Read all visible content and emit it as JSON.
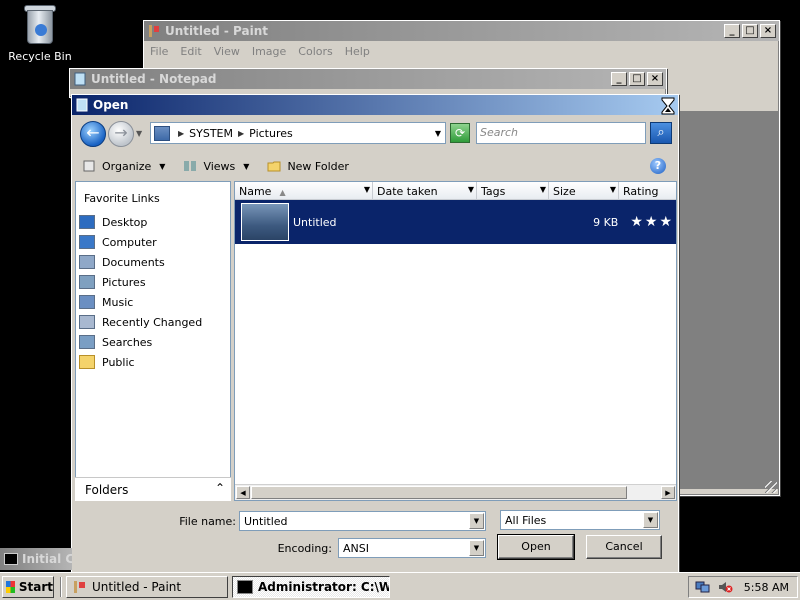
{
  "desktop": {
    "recycle_bin_label": "Recycle Bin"
  },
  "paint": {
    "title": "Untitled - Paint",
    "menu": [
      "File",
      "Edit",
      "View",
      "Image",
      "Colors",
      "Help"
    ]
  },
  "notepad": {
    "title": "Untitled - Notepad"
  },
  "dialog": {
    "title": "Open",
    "breadcrumb": [
      "SYSTEM",
      "Pictures"
    ],
    "search_placeholder": "Search",
    "toolbar": {
      "organize": "Organize",
      "views": "Views",
      "new_folder": "New Folder"
    },
    "favorite_links_header": "Favorite Links",
    "favorites": [
      {
        "label": "Desktop",
        "icon": "desktop-icon"
      },
      {
        "label": "Computer",
        "icon": "computer-icon"
      },
      {
        "label": "Documents",
        "icon": "documents-icon"
      },
      {
        "label": "Pictures",
        "icon": "pictures-icon"
      },
      {
        "label": "Music",
        "icon": "music-icon"
      },
      {
        "label": "Recently Changed",
        "icon": "recently-changed-icon"
      },
      {
        "label": "Searches",
        "icon": "searches-icon"
      },
      {
        "label": "Public",
        "icon": "public-folder-icon"
      }
    ],
    "folders_label": "Folders",
    "columns": [
      "Name",
      "Date taken",
      "Tags",
      "Size",
      "Rating"
    ],
    "files": [
      {
        "name": "Untitled",
        "size": "9 KB",
        "rating": "★★★"
      }
    ],
    "file_name_label": "File name:",
    "file_name_value": "Untitled",
    "file_type_value": "All Files",
    "encoding_label": "Encoding:",
    "encoding_value": "ANSI",
    "open_button": "Open",
    "cancel_button": "Cancel"
  },
  "console_window": {
    "title": "Initial Co"
  },
  "taskbar": {
    "start_label": "Start",
    "tasks": [
      "Untitled - Paint",
      "Administrator: C:\\Win..."
    ],
    "clock": "5:58 AM"
  },
  "colors": {
    "selection": "#0a246a",
    "active_title_start": "#0a246a",
    "inactive_title": "#808080",
    "face": "#d4d0c8"
  }
}
